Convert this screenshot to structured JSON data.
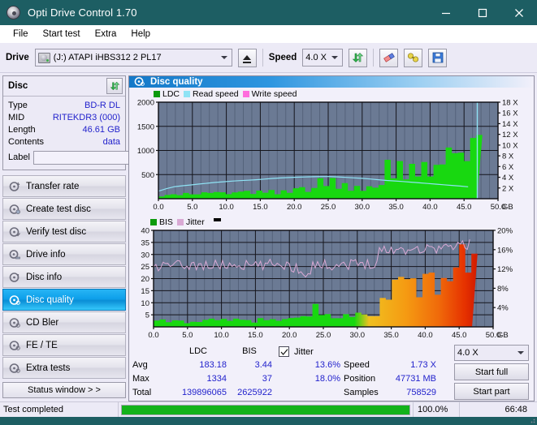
{
  "window": {
    "title": "Opti Drive Control 1.70",
    "icon": "disc-icon",
    "minimize": "–",
    "maximize": "□",
    "close": "✕"
  },
  "menu": [
    "File",
    "Start test",
    "Extra",
    "Help"
  ],
  "toolbar": {
    "drive_label": "Drive",
    "drive_value": "(J:)  ATAPI iHBS312  2 PL17",
    "eject_title": "Eject",
    "speed_label": "Speed",
    "speed_value": "4.0 X",
    "refresh_title": "refresh-icon",
    "eraser_title": "eraser-icon",
    "key_title": "key-icon",
    "save_title": "save-icon"
  },
  "disc": {
    "header": "Disc",
    "rows": [
      {
        "key": "Type",
        "value": "BD-R DL"
      },
      {
        "key": "MID",
        "value": "RITEKDR3 (000)"
      },
      {
        "key": "Length",
        "value": "46.61 GB"
      },
      {
        "key": "Contents",
        "value": "data"
      }
    ],
    "label_key": "Label",
    "label_value": ""
  },
  "nav": {
    "items": [
      {
        "label": "Transfer rate",
        "active": false
      },
      {
        "label": "Create test disc",
        "active": false
      },
      {
        "label": "Verify test disc",
        "active": false
      },
      {
        "label": "Drive info",
        "active": false
      },
      {
        "label": "Disc info",
        "active": false
      },
      {
        "label": "Disc quality",
        "active": true
      },
      {
        "label": "CD Bler",
        "active": false
      },
      {
        "label": "FE / TE",
        "active": false
      },
      {
        "label": "Extra tests",
        "active": false
      }
    ],
    "status_window": "Status window > >"
  },
  "panel": {
    "title": "Disc quality"
  },
  "stats": {
    "col_headers": [
      "",
      "LDC",
      "BIS"
    ],
    "rows": [
      {
        "key": "Avg",
        "ldc": "183.18",
        "bis": "3.44",
        "jitter": "13.6%"
      },
      {
        "key": "Max",
        "ldc": "1334",
        "bis": "37",
        "jitter": "18.0%"
      },
      {
        "key": "Total",
        "ldc": "139896065",
        "bis": "2625922",
        "jitter": ""
      }
    ],
    "jitter_label": "Jitter",
    "jitter_checked": true,
    "speed_key": "Speed",
    "speed_value": "1.73 X",
    "position_key": "Position",
    "position_value": "47731 MB",
    "samples_key": "Samples",
    "samples_value": "758529",
    "speed_select": "4.0 X",
    "start_full": "Start full",
    "start_part": "Start part"
  },
  "statusbar": {
    "text": "Test completed",
    "progress_pct": 100.0,
    "progress_label": "100.0%",
    "elapsed": "66:48"
  },
  "colors": {
    "title_bg": "#1d5e63",
    "plot_bg": "#6b7a94",
    "grid": "#2a2a32",
    "ldc_green": "#18d810",
    "read_speed": "#8fe3f5",
    "write_speed": "#ff6edd",
    "jitter_pink": "#d9a9d4",
    "bis_green": "#18d810",
    "accent_blue": "#2222cc",
    "progress_green": "#13b21a"
  },
  "chart_data": [
    {
      "type": "area",
      "name": "top-chart",
      "title": "",
      "xlabel": "GB",
      "ylabel": "",
      "xlim": [
        0,
        50
      ],
      "ylim": [
        0,
        2000
      ],
      "xticks": [
        "0.0",
        "5.0",
        "10.0",
        "15.0",
        "20.0",
        "25.0",
        "30.0",
        "35.0",
        "40.0",
        "45.0",
        "50.0"
      ],
      "yticks": [
        "500",
        "1000",
        "1500",
        "2000"
      ],
      "y2label": "X",
      "y2lim": [
        0,
        18
      ],
      "y2ticks": [
        "2 X",
        "4 X",
        "6 X",
        "8 X",
        "10 X",
        "12 X",
        "14 X",
        "16 X",
        "18 X"
      ],
      "grid": true,
      "legend": [
        {
          "name": "LDC",
          "color": "#18d810"
        },
        {
          "name": "Read speed",
          "color": "#8fe3f5"
        },
        {
          "name": "Write speed",
          "color": "#ff6edd"
        }
      ],
      "series": [
        {
          "name": "LDC",
          "kind": "area",
          "color": "#18d810",
          "x": [
            0.0,
            1.0,
            2.5,
            4.0,
            6.0,
            8.0,
            10.0,
            12.0,
            14.0,
            16.0,
            18.0,
            20.0,
            21.5,
            22.8,
            23.3,
            24.0,
            25.0,
            26.0,
            27.0,
            28.5,
            30.0,
            31.5,
            32.9,
            33.1,
            34.0,
            35.0,
            36.0,
            37.0,
            38.0,
            39.0,
            40.0,
            41.0,
            42.0,
            43.0,
            44.0,
            45.0,
            45.8,
            46.5,
            46.9
          ],
          "values": [
            60,
            80,
            95,
            110,
            120,
            130,
            150,
            140,
            160,
            155,
            170,
            190,
            230,
            260,
            500,
            300,
            430,
            300,
            330,
            260,
            240,
            250,
            255,
            790,
            700,
            720,
            700,
            740,
            720,
            760,
            800,
            850,
            900,
            980,
            1080,
            1180,
            1250,
            1300,
            1280
          ]
        },
        {
          "name": "Read speed",
          "kind": "line",
          "color": "#8fe3f5",
          "axis": "right",
          "x": [
            0.0,
            2.0,
            5.0,
            8.0,
            11.0,
            14.0,
            17.0,
            20.0,
            23.0,
            24.5,
            26.0,
            28.0,
            30.0,
            32.0,
            33.1,
            35.0,
            37.0,
            39.0,
            41.0,
            43.0,
            45.0,
            46.8
          ],
          "values": [
            1.4,
            2.2,
            2.6,
            3.0,
            3.3,
            3.5,
            3.8,
            4.0,
            4.1,
            4.15,
            4.1,
            3.95,
            3.8,
            3.6,
            3.45,
            3.3,
            3.1,
            2.9,
            2.7,
            2.5,
            2.3,
            2.05
          ]
        },
        {
          "name": "Read speed spike",
          "kind": "vline",
          "color": "#8fe3f5",
          "x": 46.95,
          "value": 18
        }
      ]
    },
    {
      "type": "area",
      "name": "bottom-chart",
      "title": "",
      "xlabel": "GB",
      "ylabel": "",
      "xlim": [
        0,
        50
      ],
      "ylim": [
        0,
        40
      ],
      "xticks": [
        "0.0",
        "5.0",
        "10.0",
        "15.0",
        "20.0",
        "25.0",
        "30.0",
        "35.0",
        "40.0",
        "45.0",
        "50.0"
      ],
      "yticks": [
        "5",
        "10",
        "15",
        "20",
        "25",
        "30",
        "35",
        "40"
      ],
      "y2lim": [
        0,
        20
      ],
      "y2ticks": [
        "4%",
        "8%",
        "12%",
        "16%",
        "20%"
      ],
      "grid": true,
      "legend": [
        {
          "name": "BIS",
          "color": "#18d810"
        },
        {
          "name": "Jitter",
          "color": "#d9a9d4"
        }
      ],
      "series": [
        {
          "name": "BIS",
          "kind": "area",
          "color": "#18d810",
          "x": [
            0.0,
            2.0,
            4.0,
            6.0,
            8.0,
            10.0,
            12.0,
            14.0,
            16.0,
            18.0,
            20.0,
            22.0,
            23.0,
            23.3,
            24.0,
            25.0,
            26.5,
            28.0,
            29.5,
            31.0,
            32.5,
            33.0,
            33.1,
            34.0,
            35.0,
            36.5,
            38.0,
            39.5,
            41.0,
            42.0,
            43.0,
            44.0,
            45.0,
            46.0,
            46.9
          ],
          "values": [
            2.5,
            2.8,
            2.6,
            3.0,
            2.9,
            3.1,
            3.0,
            3.2,
            3.1,
            3.4,
            3.6,
            4.0,
            4.5,
            12.5,
            5.5,
            5.0,
            5.4,
            5.2,
            5.6,
            5.4,
            5.6,
            5.5,
            20.0,
            19.0,
            20.5,
            19.5,
            21.0,
            20.0,
            22.0,
            23.0,
            25.0,
            27.0,
            30.0,
            33.0,
            35.0
          ]
        },
        {
          "name": "Jitter",
          "kind": "line-band",
          "color": "#d9a9d4",
          "x": [
            0.0,
            2.0,
            4.0,
            6.0,
            8.0,
            10.0,
            12.0,
            14.0,
            16.0,
            18.0,
            19.5,
            21.0,
            22.0,
            23.0,
            23.2,
            25.0,
            27.0,
            29.0,
            31.0,
            32.5,
            33.0,
            33.1,
            35.0,
            37.0,
            39.0,
            41.0,
            43.0,
            45.0,
            46.5,
            46.9
          ],
          "values": [
            12.3,
            12.6,
            12.7,
            12.8,
            12.7,
            12.8,
            12.9,
            12.7,
            12.6,
            13.2,
            12.8,
            12.2,
            11.5,
            10.8,
            13.0,
            12.8,
            12.9,
            13.0,
            13.1,
            13.3,
            13.4,
            15.9,
            16.0,
            16.1,
            16.2,
            16.3,
            16.5,
            16.8,
            17.2,
            17.5
          ],
          "band": 1.1,
          "unit": "%"
        }
      ]
    }
  ]
}
